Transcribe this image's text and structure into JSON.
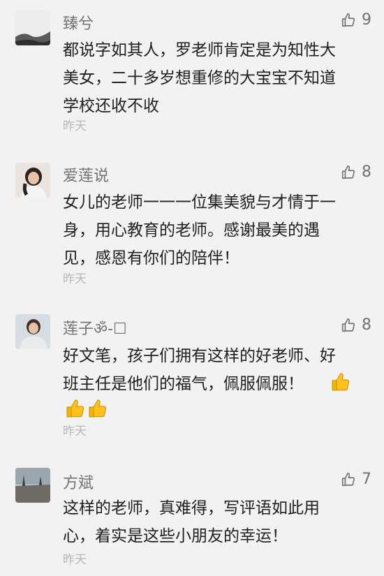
{
  "comments": [
    {
      "name": "臻兮",
      "likes": "9",
      "text": "都说字如其人，罗老师肯定是为知性大\n美女，二十多岁想重修的大宝宝不知道\n学校还收不收",
      "time": "昨天"
    },
    {
      "name": "爱莲说",
      "likes": "8",
      "text": "女儿的老师一一一位集美貌与才情于一\n身，用心教育的老师。感谢最美的遇\n见，感恩有你们的陪伴！",
      "time": "昨天"
    },
    {
      "name": "莲子ॐ-☐",
      "likes": "8",
      "text": "好文笔，孩子们拥有这样的好老师、好\n班主任是他们的福气，佩服佩服！",
      "time": "昨天"
    },
    {
      "name": "方斌",
      "likes": "7",
      "text": "这样的老师，真难得，写评语如此用\n心，着实是这些小朋友的幸运！",
      "time": "昨天"
    }
  ],
  "icons": {
    "like": "thumbs-up-outline-icon",
    "emoji": "thumbs-up-emoji-icon"
  },
  "colors": {
    "background": "#f2f2f2",
    "name": "#727272",
    "text": "#1f1f1f",
    "time": "#b7b7b7",
    "emoji": "#f4b400"
  }
}
